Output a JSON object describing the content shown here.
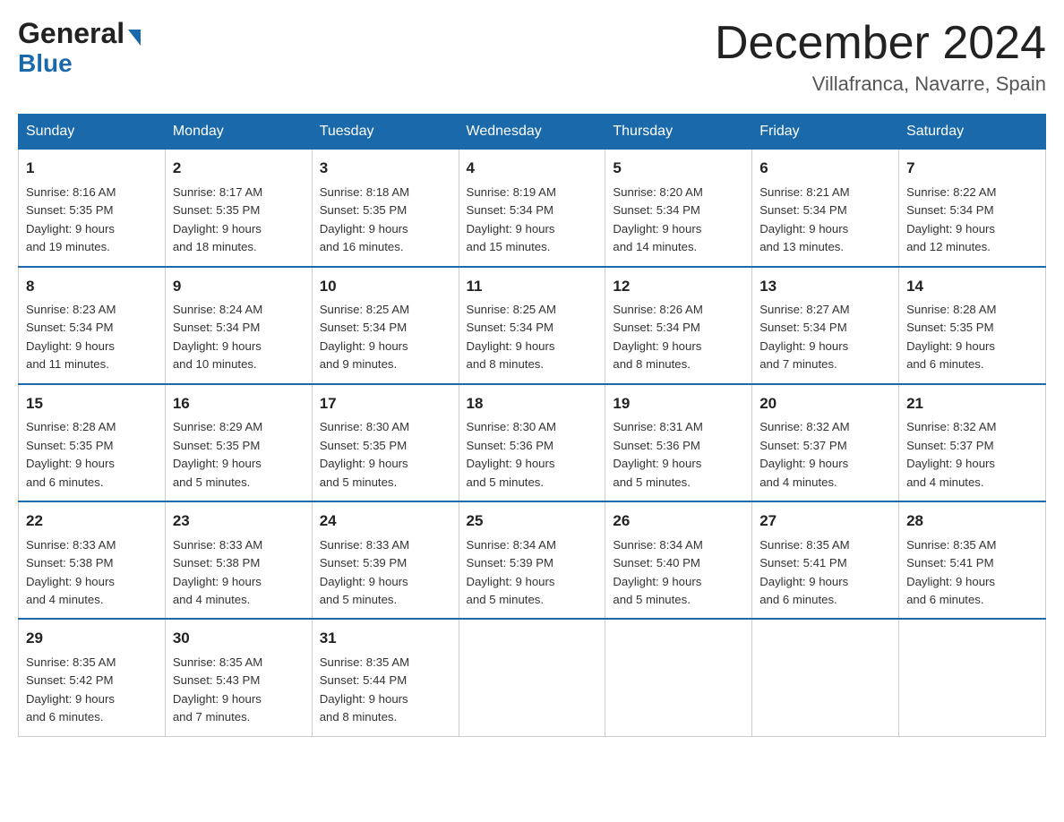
{
  "logo": {
    "general": "General",
    "blue": "Blue",
    "arrow": "▶"
  },
  "title": {
    "month": "December 2024",
    "location": "Villafranca, Navarre, Spain"
  },
  "days_of_week": [
    "Sunday",
    "Monday",
    "Tuesday",
    "Wednesday",
    "Thursday",
    "Friday",
    "Saturday"
  ],
  "weeks": [
    [
      {
        "day": "1",
        "sunrise": "8:16 AM",
        "sunset": "5:35 PM",
        "daylight": "9 hours and 19 minutes."
      },
      {
        "day": "2",
        "sunrise": "8:17 AM",
        "sunset": "5:35 PM",
        "daylight": "9 hours and 18 minutes."
      },
      {
        "day": "3",
        "sunrise": "8:18 AM",
        "sunset": "5:35 PM",
        "daylight": "9 hours and 16 minutes."
      },
      {
        "day": "4",
        "sunrise": "8:19 AM",
        "sunset": "5:34 PM",
        "daylight": "9 hours and 15 minutes."
      },
      {
        "day": "5",
        "sunrise": "8:20 AM",
        "sunset": "5:34 PM",
        "daylight": "9 hours and 14 minutes."
      },
      {
        "day": "6",
        "sunrise": "8:21 AM",
        "sunset": "5:34 PM",
        "daylight": "9 hours and 13 minutes."
      },
      {
        "day": "7",
        "sunrise": "8:22 AM",
        "sunset": "5:34 PM",
        "daylight": "9 hours and 12 minutes."
      }
    ],
    [
      {
        "day": "8",
        "sunrise": "8:23 AM",
        "sunset": "5:34 PM",
        "daylight": "9 hours and 11 minutes."
      },
      {
        "day": "9",
        "sunrise": "8:24 AM",
        "sunset": "5:34 PM",
        "daylight": "9 hours and 10 minutes."
      },
      {
        "day": "10",
        "sunrise": "8:25 AM",
        "sunset": "5:34 PM",
        "daylight": "9 hours and 9 minutes."
      },
      {
        "day": "11",
        "sunrise": "8:25 AM",
        "sunset": "5:34 PM",
        "daylight": "9 hours and 8 minutes."
      },
      {
        "day": "12",
        "sunrise": "8:26 AM",
        "sunset": "5:34 PM",
        "daylight": "9 hours and 8 minutes."
      },
      {
        "day": "13",
        "sunrise": "8:27 AM",
        "sunset": "5:34 PM",
        "daylight": "9 hours and 7 minutes."
      },
      {
        "day": "14",
        "sunrise": "8:28 AM",
        "sunset": "5:35 PM",
        "daylight": "9 hours and 6 minutes."
      }
    ],
    [
      {
        "day": "15",
        "sunrise": "8:28 AM",
        "sunset": "5:35 PM",
        "daylight": "9 hours and 6 minutes."
      },
      {
        "day": "16",
        "sunrise": "8:29 AM",
        "sunset": "5:35 PM",
        "daylight": "9 hours and 5 minutes."
      },
      {
        "day": "17",
        "sunrise": "8:30 AM",
        "sunset": "5:35 PM",
        "daylight": "9 hours and 5 minutes."
      },
      {
        "day": "18",
        "sunrise": "8:30 AM",
        "sunset": "5:36 PM",
        "daylight": "9 hours and 5 minutes."
      },
      {
        "day": "19",
        "sunrise": "8:31 AM",
        "sunset": "5:36 PM",
        "daylight": "9 hours and 5 minutes."
      },
      {
        "day": "20",
        "sunrise": "8:32 AM",
        "sunset": "5:37 PM",
        "daylight": "9 hours and 4 minutes."
      },
      {
        "day": "21",
        "sunrise": "8:32 AM",
        "sunset": "5:37 PM",
        "daylight": "9 hours and 4 minutes."
      }
    ],
    [
      {
        "day": "22",
        "sunrise": "8:33 AM",
        "sunset": "5:38 PM",
        "daylight": "9 hours and 4 minutes."
      },
      {
        "day": "23",
        "sunrise": "8:33 AM",
        "sunset": "5:38 PM",
        "daylight": "9 hours and 4 minutes."
      },
      {
        "day": "24",
        "sunrise": "8:33 AM",
        "sunset": "5:39 PM",
        "daylight": "9 hours and 5 minutes."
      },
      {
        "day": "25",
        "sunrise": "8:34 AM",
        "sunset": "5:39 PM",
        "daylight": "9 hours and 5 minutes."
      },
      {
        "day": "26",
        "sunrise": "8:34 AM",
        "sunset": "5:40 PM",
        "daylight": "9 hours and 5 minutes."
      },
      {
        "day": "27",
        "sunrise": "8:35 AM",
        "sunset": "5:41 PM",
        "daylight": "9 hours and 6 minutes."
      },
      {
        "day": "28",
        "sunrise": "8:35 AM",
        "sunset": "5:41 PM",
        "daylight": "9 hours and 6 minutes."
      }
    ],
    [
      {
        "day": "29",
        "sunrise": "8:35 AM",
        "sunset": "5:42 PM",
        "daylight": "9 hours and 6 minutes."
      },
      {
        "day": "30",
        "sunrise": "8:35 AM",
        "sunset": "5:43 PM",
        "daylight": "9 hours and 7 minutes."
      },
      {
        "day": "31",
        "sunrise": "8:35 AM",
        "sunset": "5:44 PM",
        "daylight": "9 hours and 8 minutes."
      },
      null,
      null,
      null,
      null
    ]
  ],
  "labels": {
    "sunrise": "Sunrise:",
    "sunset": "Sunset:",
    "daylight": "Daylight:"
  }
}
